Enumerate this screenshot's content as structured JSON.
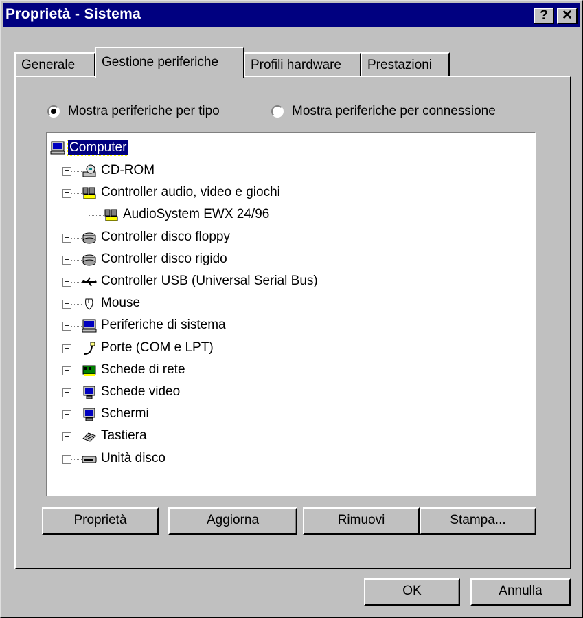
{
  "window": {
    "title": "Proprietà - Sistema",
    "help_label": "?",
    "close_label": "✕"
  },
  "tabs": [
    {
      "label": "Generale"
    },
    {
      "label": "Gestione periferiche"
    },
    {
      "label": "Profili hardware"
    },
    {
      "label": "Prestazioni"
    }
  ],
  "view_options": {
    "by_type": {
      "label": "Mostra periferiche per tipo",
      "selected": true
    },
    "by_connection": {
      "label": "Mostra periferiche per connessione",
      "selected": false
    }
  },
  "tree": {
    "root": "Computer",
    "items": [
      {
        "label": "CD-ROM",
        "icon": "cdrom-icon",
        "expander": "+"
      },
      {
        "label": "Controller audio, video e giochi",
        "icon": "multimedia-icon",
        "expander": "−"
      },
      {
        "label": "AudioSystem EWX 24/96",
        "icon": "multimedia-icon",
        "expander": ""
      },
      {
        "label": "Controller disco floppy",
        "icon": "drive-controller-icon",
        "expander": "+"
      },
      {
        "label": "Controller disco rigido",
        "icon": "drive-controller-icon",
        "expander": "+"
      },
      {
        "label": "Controller USB (Universal Serial Bus)",
        "icon": "usb-icon",
        "expander": "+"
      },
      {
        "label": "Mouse",
        "icon": "mouse-icon",
        "expander": "+"
      },
      {
        "label": "Periferiche di sistema",
        "icon": "system-devices-icon",
        "expander": "+"
      },
      {
        "label": "Porte (COM e LPT)",
        "icon": "port-icon",
        "expander": "+"
      },
      {
        "label": "Schede di rete",
        "icon": "network-card-icon",
        "expander": "+"
      },
      {
        "label": "Schede video",
        "icon": "display-adapter-icon",
        "expander": "+"
      },
      {
        "label": "Schermi",
        "icon": "monitor-icon",
        "expander": "+"
      },
      {
        "label": "Tastiera",
        "icon": "keyboard-icon",
        "expander": "+"
      },
      {
        "label": "Unità disco",
        "icon": "disk-drive-icon",
        "expander": "+"
      }
    ]
  },
  "buttons": {
    "properties": "Proprietà",
    "refresh": "Aggiorna",
    "remove": "Rimuovi",
    "print": "Stampa...",
    "ok": "OK",
    "cancel": "Annulla"
  },
  "colors": {
    "title_bar": "#000080",
    "face": "#c0c0c0",
    "selection": "#000080"
  }
}
